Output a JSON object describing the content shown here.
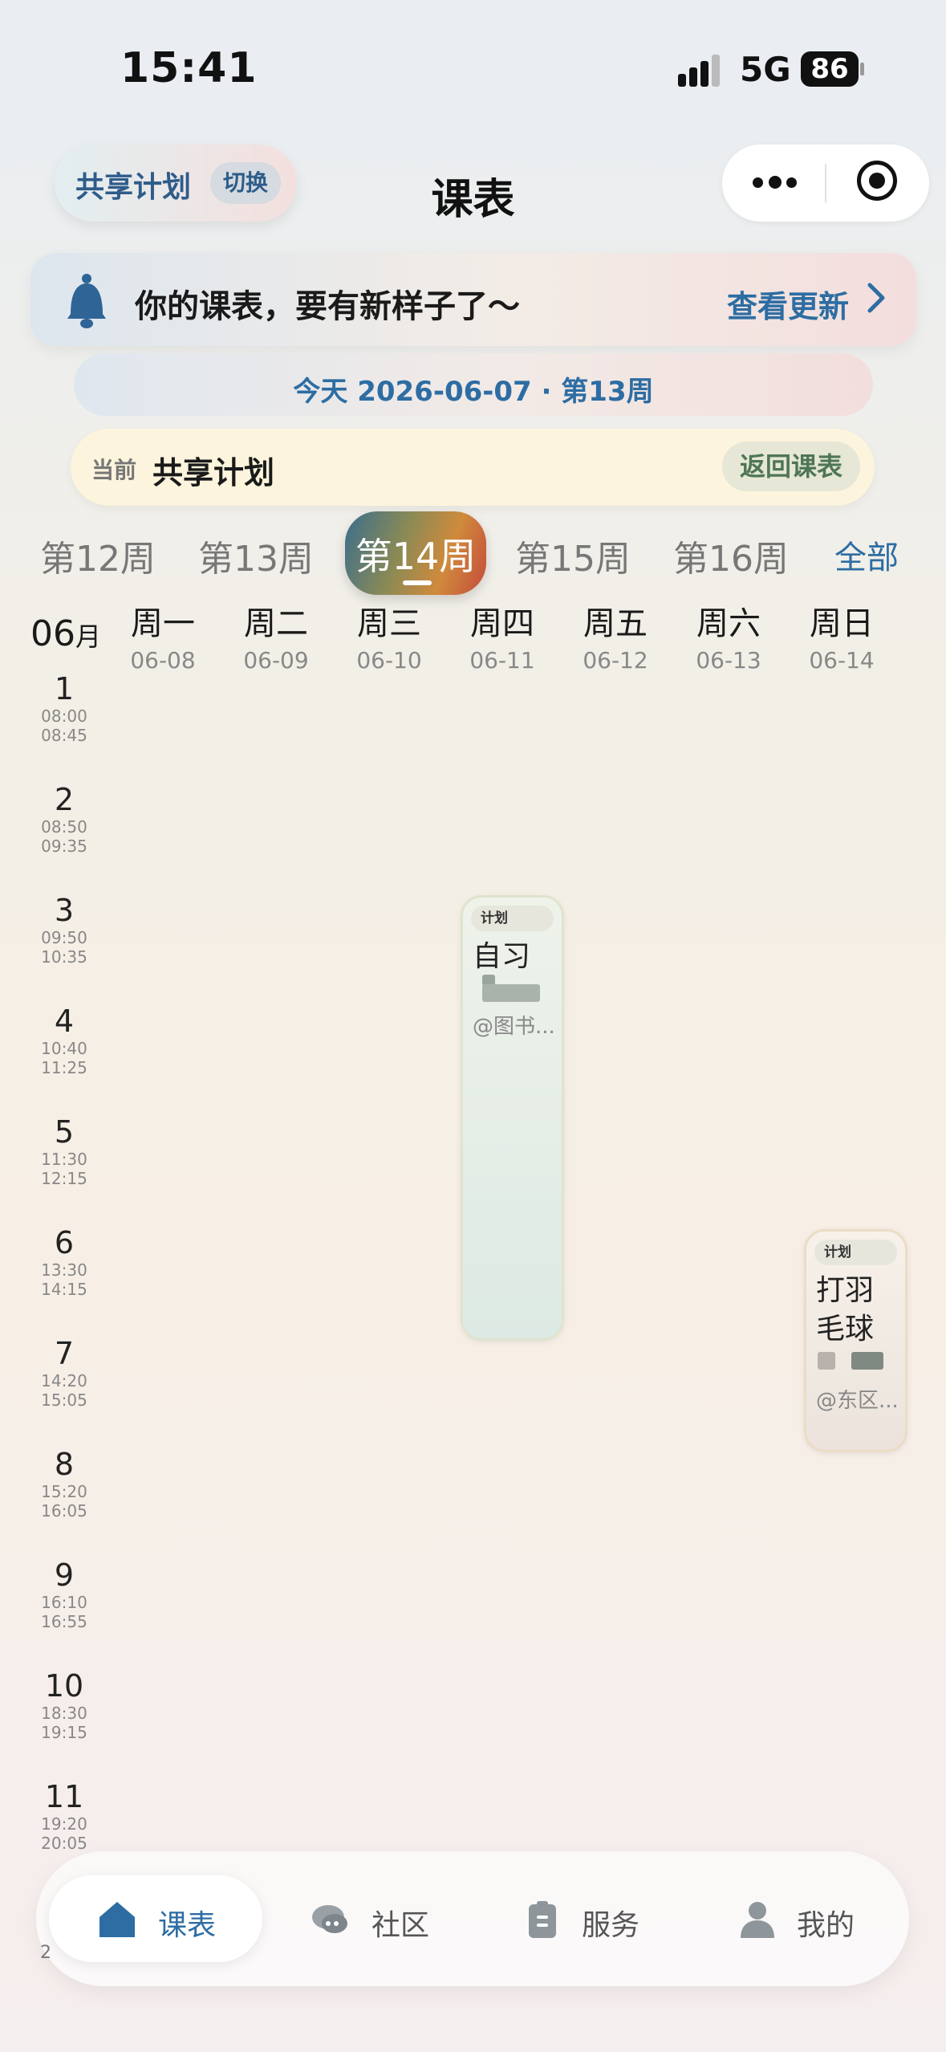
{
  "status_bar": {
    "time": "15:41",
    "network": "5G",
    "battery": "86"
  },
  "nav": {
    "plan_label": "共享计划",
    "switch_label": "切换",
    "title": "课表"
  },
  "banner": {
    "text": "你的课表，要有新样子了～",
    "link": "查看更新"
  },
  "today": {
    "text": "今天 2026-06-07 · 第13周"
  },
  "current_plan": {
    "prefix": "当前",
    "name": "共享计划",
    "back_label": "返回课表"
  },
  "weeks": {
    "items": [
      "第12周",
      "第13周",
      "第14周",
      "第15周",
      "第16周"
    ],
    "active": "第14周",
    "all_label": "全部"
  },
  "calendar": {
    "month_num": "06",
    "month_unit": "月",
    "days": [
      {
        "name": "周一",
        "date": "06-08"
      },
      {
        "name": "周二",
        "date": "06-09"
      },
      {
        "name": "周三",
        "date": "06-10"
      },
      {
        "name": "周四",
        "date": "06-11"
      },
      {
        "name": "周五",
        "date": "06-12"
      },
      {
        "name": "周六",
        "date": "06-13"
      },
      {
        "name": "周日",
        "date": "06-14"
      }
    ],
    "periods": [
      {
        "num": "1",
        "start": "08:00",
        "end": "08:45"
      },
      {
        "num": "2",
        "start": "08:50",
        "end": "09:35"
      },
      {
        "num": "3",
        "start": "09:50",
        "end": "10:35"
      },
      {
        "num": "4",
        "start": "10:40",
        "end": "11:25"
      },
      {
        "num": "5",
        "start": "11:30",
        "end": "12:15"
      },
      {
        "num": "6",
        "start": "13:30",
        "end": "14:15"
      },
      {
        "num": "7",
        "start": "14:20",
        "end": "15:05"
      },
      {
        "num": "8",
        "start": "15:20",
        "end": "16:05"
      },
      {
        "num": "9",
        "start": "16:10",
        "end": "16:55"
      },
      {
        "num": "10",
        "start": "18:30",
        "end": "19:15"
      },
      {
        "num": "11",
        "start": "19:20",
        "end": "20:05"
      }
    ],
    "courses": [
      {
        "tag": "计划",
        "name": "自习",
        "location": "@图书..."
      },
      {
        "tag": "计划",
        "name_line1": "打羽",
        "name_line2": "毛球",
        "location": "@东区..."
      }
    ]
  },
  "bottom_nav": {
    "items": [
      {
        "label": "课表",
        "icon": "home-icon"
      },
      {
        "label": "社区",
        "icon": "chat-icon"
      },
      {
        "label": "服务",
        "icon": "clipboard-icon"
      },
      {
        "label": "我的",
        "icon": "person-icon"
      }
    ],
    "active_color": "#2d6da3"
  },
  "corner_digit": "2"
}
